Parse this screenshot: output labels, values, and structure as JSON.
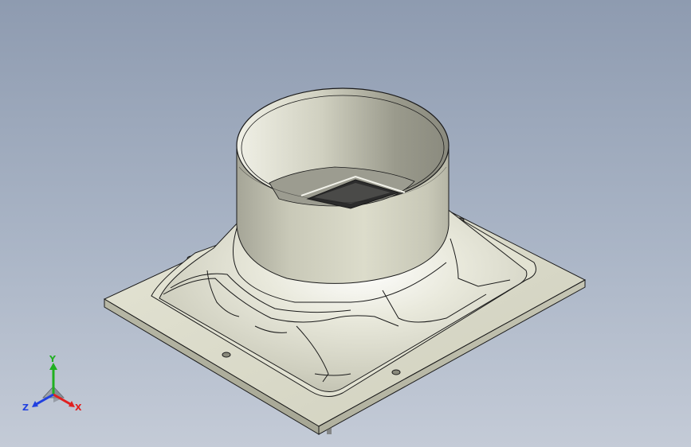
{
  "triad": {
    "x_label": "X",
    "y_label": "Y",
    "z_label": "Z",
    "x_color": "#e02020",
    "y_color": "#20b020",
    "z_color": "#2040e0"
  },
  "colors": {
    "background_top": "#8e9bb0",
    "background_bottom": "#c4cbd7",
    "plate": "#d8d8c8",
    "body": "#d4d3c2",
    "edge": "#1a1a1a"
  }
}
